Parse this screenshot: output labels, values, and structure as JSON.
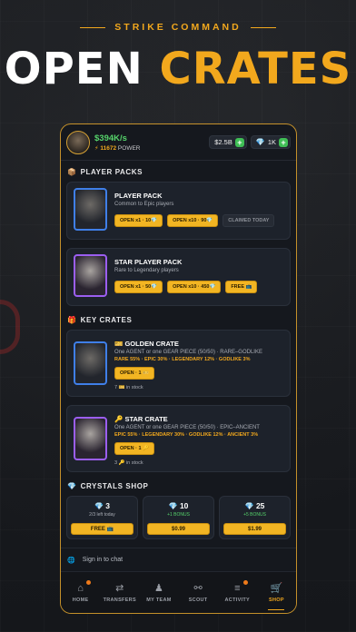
{
  "header": {
    "subtitle": "STRIKE COMMAND",
    "headline_1": "OPEN",
    "headline_2": "CRATES"
  },
  "status": {
    "income_rate": "$394K/s",
    "power_value": "11672",
    "power_label": "POWER",
    "cash": "$2.5B",
    "crystals": "1K"
  },
  "player_packs": {
    "title": "PLAYER PACKS",
    "items": [
      {
        "title": "PLAYER PACK",
        "desc": "Common to Epic players",
        "buttons": [
          "OPEN x1 · 10💎",
          "OPEN x10 · 90💎"
        ],
        "tag": "CLAIMED TODAY"
      },
      {
        "title": "STAR PLAYER PACK",
        "desc": "Rare to Legendary players",
        "buttons": [
          "OPEN x1 · 50💎",
          "OPEN x10 · 450💎"
        ],
        "free": "FREE 📺"
      }
    ]
  },
  "key_crates": {
    "title": "KEY CRATES",
    "items": [
      {
        "title": "GOLDEN CRATE",
        "desc": "One AGENT or one GEAR PIECE (50/50) · RARE–GODLIKE",
        "rates": "RARE 55% · EPIC 30% · LEGENDARY 12% · GODLIKE 3%",
        "button": "OPEN · 1 🎫",
        "stock": "7 🎫 in stock"
      },
      {
        "title": "STAR CRATE",
        "desc": "One AGENT or one GEAR PIECE (50/50) · EPIC–ANCIENT",
        "rates": "EPIC 55% · LEGENDARY 30% · GODLIKE 12% · ANCIENT 3%",
        "button": "OPEN · 1 🔑",
        "stock": "3 🔑 in stock"
      }
    ]
  },
  "crystals_shop": {
    "title": "CRYSTALS SHOP",
    "items": [
      {
        "amount": "3",
        "sub": "2/3 left today",
        "button": "FREE 📺"
      },
      {
        "amount": "10",
        "sub": "+1 BONUS",
        "button": "$0.99"
      },
      {
        "amount": "25",
        "sub": "+5 BONUS",
        "button": "$1.99"
      }
    ]
  },
  "signin": {
    "label": "Sign in to chat"
  },
  "tabs": [
    {
      "label": "HOME",
      "icon": "home-icon"
    },
    {
      "label": "TRANSFERS",
      "icon": "transfer-icon"
    },
    {
      "label": "MY TEAM",
      "icon": "team-icon"
    },
    {
      "label": "SCOUT",
      "icon": "binoculars-icon"
    },
    {
      "label": "ACTIVITY",
      "icon": "activity-icon"
    },
    {
      "label": "SHOP",
      "icon": "cart-icon"
    }
  ],
  "colors": {
    "accent": "#f2a81d",
    "green": "#56d36b",
    "blue_frame": "#3f7fe8",
    "purple_frame": "#9b5ef0"
  }
}
